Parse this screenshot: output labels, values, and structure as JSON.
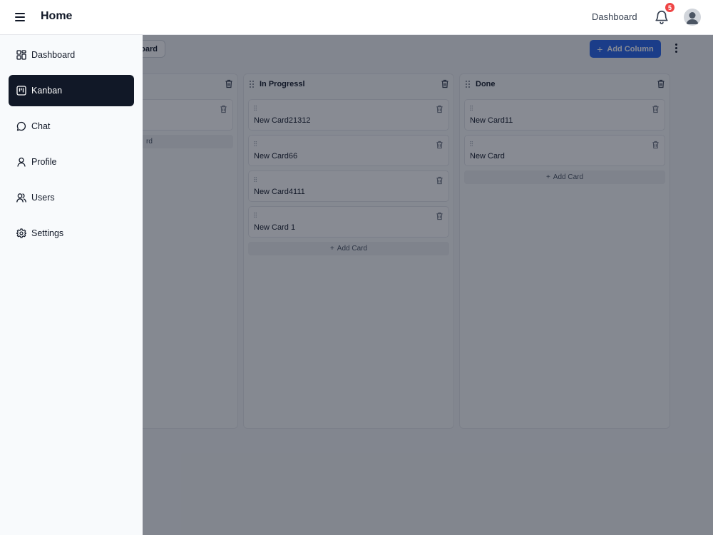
{
  "header": {
    "title": "Home",
    "link": "Dashboard",
    "notification_count": "5"
  },
  "toolbar": {
    "board_button_partial": "oard",
    "add_column_label": "Add Column",
    "add_column_plus": "+"
  },
  "columns": [
    {
      "title": "",
      "cards": [
        ""
      ],
      "add_card_partial": "rd"
    },
    {
      "title": "In Progressl",
      "cards": [
        "New Card21312",
        "New Card66",
        "New Card4111",
        "New Card 1"
      ],
      "add_card_label": "Add Card"
    },
    {
      "title": "Done",
      "cards": [
        "New Card11",
        "New Card"
      ],
      "add_card_label": "Add Card"
    }
  ],
  "sidebar": {
    "items": [
      {
        "label": "Dashboard",
        "icon": "dashboard-icon"
      },
      {
        "label": "Kanban",
        "icon": "kanban-icon",
        "active": true
      },
      {
        "label": "Chat",
        "icon": "chat-icon"
      },
      {
        "label": "Profile",
        "icon": "profile-icon"
      },
      {
        "label": "Users",
        "icon": "users-icon"
      },
      {
        "label": "Settings",
        "icon": "settings-icon"
      }
    ]
  },
  "colors": {
    "accent": "#2563eb",
    "active_nav": "#111827",
    "badge": "#ef4444"
  }
}
